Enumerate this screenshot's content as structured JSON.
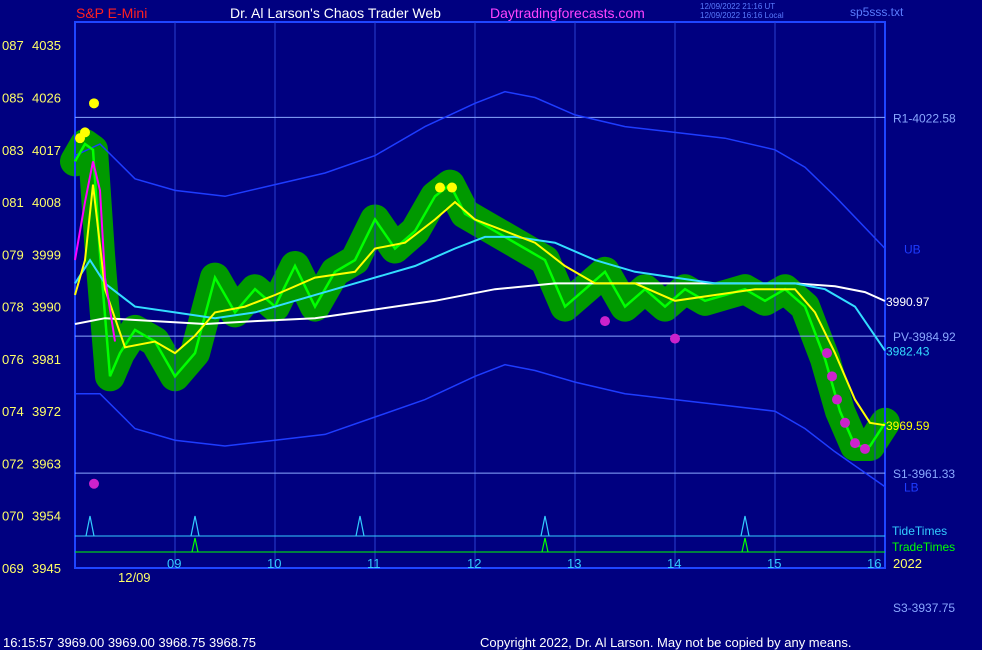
{
  "header": {
    "symbol": "S&P E-Mini",
    "author": "Dr. Al Larson's Chaos Trader Web",
    "site": "Daytradingforecasts.com",
    "stamp_utc": "12/09/2022 21:16 UT",
    "stamp_local": "12/09/2022 16:16 Local",
    "file": "sp5sss.txt"
  },
  "footer": {
    "quote": "16:15:57  3969.00 3969.00 3968.75 3968.75",
    "copyright": "Copyright 2022, Dr. Al Larson. May not be copied by any means."
  },
  "colors": {
    "background": "#000080",
    "frame": "#1f45ff",
    "price_green": "#00ff00",
    "halo_green": "#009900",
    "ma_fast_magenta": "#ff00ff",
    "ma_yellow": "#ffff00",
    "ma_cyan": "#33ddff",
    "ma_white": "#ffffff",
    "band_blue": "#1e3cff",
    "level_line": "#8aa8ff",
    "tide": "#33ccff",
    "trade": "#00ff00",
    "title_red": "#ff2020",
    "site_magenta": "#ff44ff"
  },
  "chart_data": {
    "type": "line",
    "title": "S&P E-Mini",
    "ylim": [
      3945,
      4039
    ],
    "y_ticks": [
      {
        "left": "069",
        "price": "3945",
        "value": 3945
      },
      {
        "left": "070",
        "price": "3954",
        "value": 3954
      },
      {
        "left": "072",
        "price": "3963",
        "value": 3963
      },
      {
        "left": "074",
        "price": "3972",
        "value": 3972
      },
      {
        "left": "076",
        "price": "3981",
        "value": 3981
      },
      {
        "left": "078",
        "price": "3990",
        "value": 3990
      },
      {
        "left": "079",
        "price": "3999",
        "value": 3999
      },
      {
        "left": "081",
        "price": "4008",
        "value": 4008
      },
      {
        "left": "083",
        "price": "4017",
        "value": 4017
      },
      {
        "left": "085",
        "price": "4026",
        "value": 4026
      },
      {
        "left": "087",
        "price": "4035",
        "value": 4035
      }
    ],
    "xlim": [
      8.0,
      16.1
    ],
    "hour_ticks": [
      {
        "label": "09",
        "x": 9.0
      },
      {
        "label": "10",
        "x": 10.0
      },
      {
        "label": "11",
        "x": 11.0
      },
      {
        "label": "12",
        "x": 12.0
      },
      {
        "label": "13",
        "x": 13.0
      },
      {
        "label": "14",
        "x": 14.0
      },
      {
        "label": "15",
        "x": 15.0
      },
      {
        "label": "16",
        "x": 16.0
      }
    ],
    "date_label": "12/09",
    "year_label": "2022",
    "levels": [
      {
        "name": "R1",
        "label": "R1-4022.58",
        "value": 4022.58
      },
      {
        "name": "PV",
        "label": "PV-3984.92",
        "value": 3984.92
      },
      {
        "name": "S1",
        "label": "S1-3961.33",
        "value": 3961.33
      }
    ],
    "offscale_label": "S3-3937.75",
    "band_labels": {
      "upper": "UB",
      "lower": "LB"
    },
    "end_labels": {
      "white": "3990.97",
      "cyan": "3982.43",
      "yellow": "3969.59"
    },
    "series": [
      {
        "name": "price",
        "x": [
          8.0,
          8.1,
          8.18,
          8.25,
          8.35,
          8.45,
          8.6,
          8.8,
          9.0,
          9.2,
          9.4,
          9.6,
          9.8,
          10.0,
          10.2,
          10.4,
          10.6,
          10.8,
          11.0,
          11.2,
          11.4,
          11.6,
          11.75,
          11.9,
          12.1,
          12.3,
          12.5,
          12.7,
          12.9,
          13.1,
          13.3,
          13.5,
          13.7,
          13.9,
          14.1,
          14.3,
          14.5,
          14.7,
          14.9,
          15.1,
          15.3,
          15.5,
          15.65,
          15.8,
          15.95,
          16.1
        ],
        "y": [
          4015,
          4018,
          4017,
          3999,
          3978,
          3982,
          3986,
          3984,
          3978,
          3982,
          3995,
          3989,
          3993,
          3990,
          3997,
          3990,
          3996,
          3998,
          4005,
          4000,
          4003,
          4009,
          4011,
          4006,
          4004,
          4002,
          4000,
          3998,
          3990,
          3993,
          3996,
          3990,
          3993,
          3990,
          3993,
          3991,
          3992,
          3993,
          3991,
          3993,
          3990,
          3981,
          3972,
          3966,
          3966,
          3970
        ]
      },
      {
        "name": "fast MA",
        "x": [
          8.0,
          8.1,
          8.18,
          8.25,
          8.3,
          8.4
        ],
        "y": [
          3998,
          4008,
          4015,
          4010,
          3995,
          3984
        ]
      },
      {
        "name": "yellow MA",
        "x": [
          8.0,
          8.1,
          8.18,
          8.3,
          8.5,
          8.8,
          9.0,
          9.2,
          9.4,
          9.7,
          10.0,
          10.4,
          10.8,
          11.0,
          11.3,
          11.6,
          11.8,
          12.0,
          12.3,
          12.6,
          12.9,
          13.2,
          13.6,
          14.0,
          14.4,
          14.8,
          15.2,
          15.4,
          15.6,
          15.8,
          15.95,
          16.1
        ],
        "y": [
          3992,
          3998,
          4011,
          3993,
          3983,
          3984,
          3982,
          3985,
          3989,
          3990,
          3992,
          3995,
          3996,
          4000,
          4001,
          4005,
          4008,
          4005,
          4003,
          4001,
          3997,
          3994,
          3994,
          3991,
          3992,
          3993,
          3993,
          3989,
          3982,
          3974,
          3970,
          3969.59
        ]
      },
      {
        "name": "cyan MA",
        "x": [
          8.0,
          8.15,
          8.3,
          8.6,
          9.0,
          9.4,
          9.8,
          10.2,
          10.6,
          11.0,
          11.4,
          11.8,
          12.1,
          12.4,
          12.8,
          13.2,
          13.6,
          14.0,
          14.4,
          14.8,
          15.2,
          15.5,
          15.8,
          16.1
        ],
        "y": [
          3994,
          3998,
          3994,
          3990,
          3989,
          3988,
          3989,
          3991,
          3993,
          3995,
          3997,
          4000,
          4002,
          4002,
          4001,
          3998,
          3996,
          3995,
          3994,
          3994,
          3994,
          3993,
          3990,
          3982.43
        ]
      },
      {
        "name": "white MA",
        "x": [
          8.0,
          8.3,
          8.8,
          9.3,
          9.8,
          10.4,
          11.0,
          11.6,
          12.2,
          12.8,
          13.4,
          14.0,
          14.6,
          15.2,
          15.6,
          15.9,
          16.1
        ],
        "y": [
          3987,
          3988,
          3987.5,
          3987,
          3987.5,
          3988,
          3989.5,
          3991,
          3993,
          3994,
          3994,
          3994,
          3994,
          3994,
          3993.5,
          3992.5,
          3990.97
        ]
      },
      {
        "name": "UB",
        "x": [
          8.0,
          8.25,
          8.6,
          9.0,
          9.5,
          10.0,
          10.5,
          11.0,
          11.5,
          12.0,
          12.3,
          12.6,
          13.0,
          13.5,
          14.0,
          14.5,
          15.0,
          15.3,
          15.6,
          16.1
        ],
        "y": [
          4016,
          4018,
          4012,
          4010,
          4009,
          4011,
          4013,
          4016,
          4021,
          4025,
          4027,
          4026,
          4023,
          4021,
          4020,
          4019,
          4017,
          4014,
          4009,
          4000
        ]
      },
      {
        "name": "LB",
        "x": [
          8.0,
          8.25,
          8.6,
          9.0,
          9.5,
          10.0,
          10.5,
          11.0,
          11.5,
          12.0,
          12.3,
          12.6,
          13.0,
          13.5,
          14.0,
          14.5,
          15.0,
          15.3,
          15.6,
          16.1
        ],
        "y": [
          3975,
          3975,
          3969,
          3967,
          3966,
          3967,
          3968,
          3971,
          3974,
          3978,
          3980,
          3979,
          3977,
          3975,
          3974,
          3973,
          3972,
          3969,
          3965,
          3959
        ]
      }
    ],
    "markers": [
      {
        "color": "yellow",
        "x": 8.19,
        "y": 4025
      },
      {
        "color": "yellow",
        "x": 8.05,
        "y": 4019
      },
      {
        "color": "yellow",
        "x": 8.1,
        "y": 4020
      },
      {
        "color": "yellow",
        "x": 11.65,
        "y": 4010.5
      },
      {
        "color": "yellow",
        "x": 11.77,
        "y": 4010.5
      },
      {
        "color": "magenta",
        "x": 8.19,
        "y": 3959.5
      },
      {
        "color": "magenta",
        "x": 13.3,
        "y": 3987.5
      },
      {
        "color": "magenta",
        "x": 14.0,
        "y": 3984.5
      },
      {
        "color": "magenta",
        "x": 15.52,
        "y": 3982
      },
      {
        "color": "magenta",
        "x": 15.57,
        "y": 3978
      },
      {
        "color": "magenta",
        "x": 15.62,
        "y": 3974
      },
      {
        "color": "magenta",
        "x": 15.7,
        "y": 3970
      },
      {
        "color": "magenta",
        "x": 15.8,
        "y": 3966.5
      },
      {
        "color": "magenta",
        "x": 15.9,
        "y": 3965.5
      }
    ],
    "tide_times": {
      "label": "TideTimes",
      "x": [
        8.15,
        9.2,
        10.85,
        12.7,
        14.7
      ]
    },
    "trade_times": {
      "label": "TradeTimes",
      "x": [
        9.2,
        12.7,
        14.7
      ]
    }
  }
}
